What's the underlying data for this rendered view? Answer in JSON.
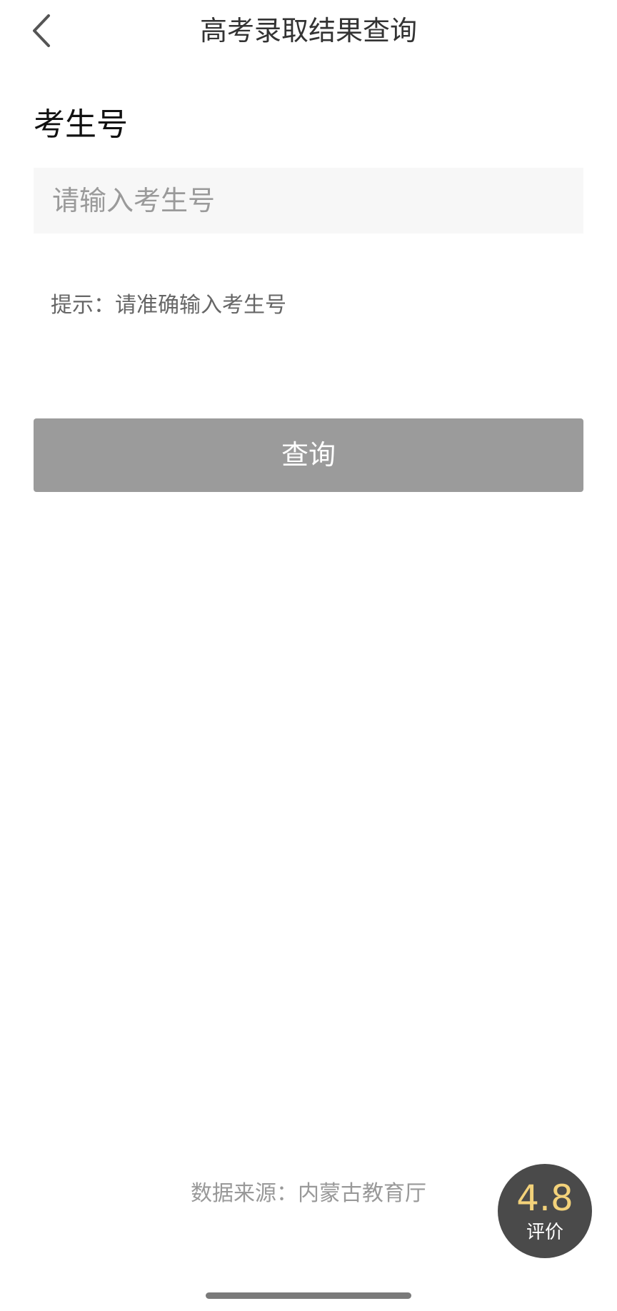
{
  "header": {
    "back_icon": "chevron-left-icon",
    "title": "高考录取结果查询"
  },
  "form": {
    "field_label": "考生号",
    "input_placeholder": "请输入考生号",
    "input_value": "",
    "hint": "提示：请准确输入考生号",
    "submit_label": "查询"
  },
  "footer": {
    "data_source": "数据来源：内蒙古教育厅"
  },
  "rating": {
    "score": "4.8",
    "label": "评价"
  },
  "colors": {
    "button_bg": "#9b9b9b",
    "input_bg": "#f7f7f7",
    "rating_bg": "#4a4a4a",
    "rating_score": "#f3d27a"
  }
}
